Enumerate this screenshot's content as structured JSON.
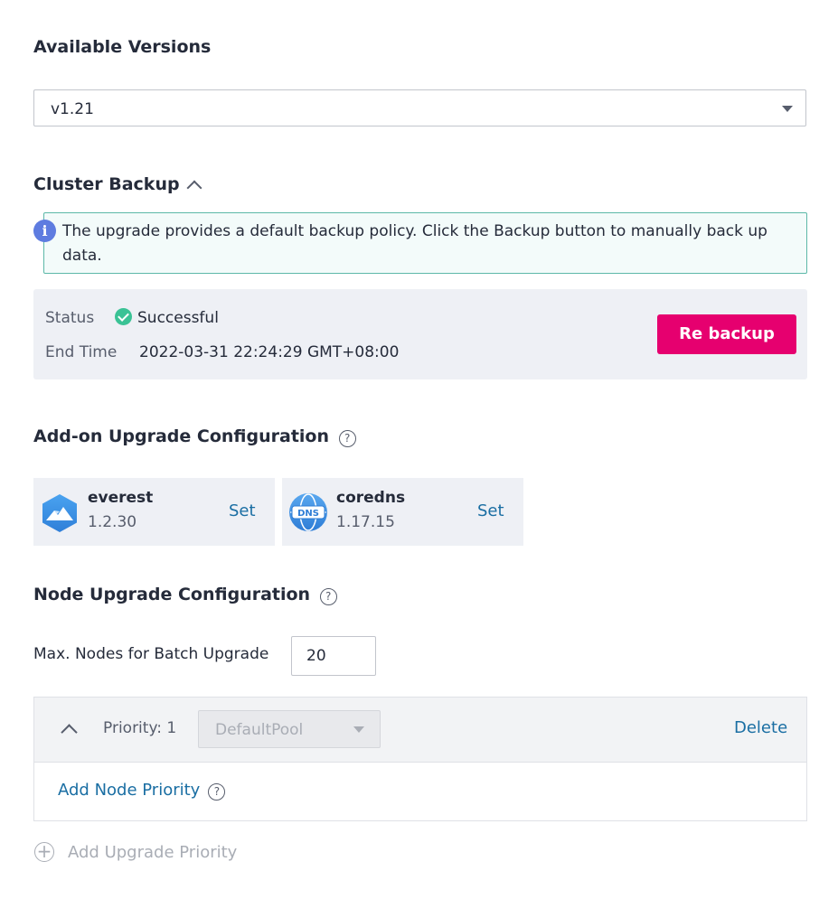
{
  "versions": {
    "title": "Available Versions",
    "selected": "v1.21"
  },
  "backup": {
    "title": "Cluster Backup",
    "info": "The upgrade provides a default backup policy. Click the Backup button to manually back up data.",
    "status_label": "Status",
    "status_value": "Successful",
    "end_time_label": "End Time",
    "end_time_value": "2022-03-31 22:24:29 GMT+08:00",
    "rebackup_label": "Re backup"
  },
  "addons": {
    "title": "Add-on Upgrade Configuration",
    "items": [
      {
        "name": "everest",
        "version": "1.2.30",
        "action": "Set",
        "icon": "everest-icon"
      },
      {
        "name": "coredns",
        "version": "1.17.15",
        "action": "Set",
        "icon": "dns-icon",
        "icon_text": "DNS"
      }
    ]
  },
  "nodes": {
    "title": "Node Upgrade Configuration",
    "max_label": "Max. Nodes for Batch Upgrade",
    "max_value": "20",
    "priority_label": "Priority: 1",
    "pool_value": "DefaultPool",
    "delete_label": "Delete",
    "add_node_priority": "Add Node Priority",
    "add_upgrade_priority": "Add Upgrade Priority"
  },
  "colors": {
    "accent": "#e6006f",
    "link": "#1a6ea3",
    "success": "#3ac295",
    "info": "#5e7ce0"
  }
}
